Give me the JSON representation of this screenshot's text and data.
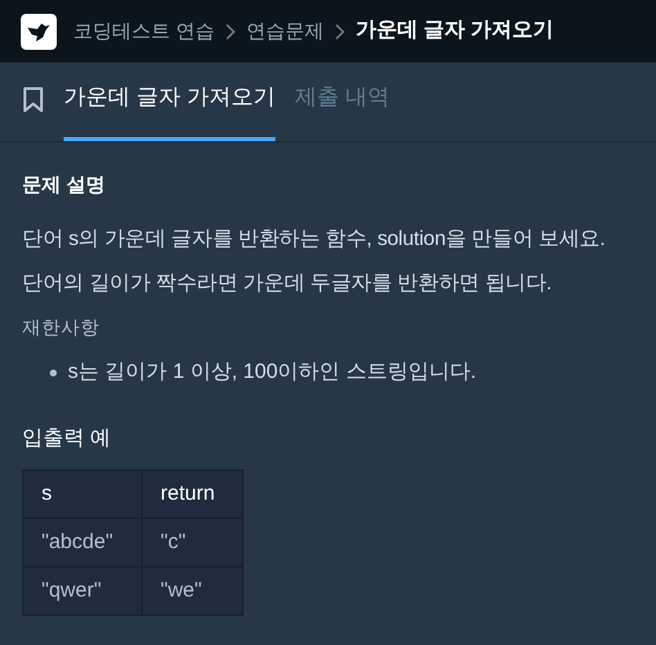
{
  "breadcrumb": [
    {
      "label": "코딩테스트 연습",
      "current": false
    },
    {
      "label": "연습문제",
      "current": false
    },
    {
      "label": "가운데 글자 가져오기",
      "current": true
    }
  ],
  "tabs": [
    {
      "label": "가운데 글자 가져오기",
      "selected": true
    },
    {
      "label": "제출 내역",
      "selected": false
    }
  ],
  "description": {
    "heading": "문제 설명",
    "paragraphs": [
      "단어 s의 가운데 글자를 반환하는 함수, solution을 만들어 보세요.",
      "단어의 길이가 짝수라면 가운데 두글자를 반환하면 됩니다."
    ]
  },
  "constraints": {
    "heading": "재한사항",
    "items": [
      "s는 길이가 1 이상, 100이하인 스트링입니다."
    ]
  },
  "examples": {
    "heading": "입출력 예",
    "columns": [
      "s",
      "return"
    ],
    "rows": [
      [
        "\"abcde\"",
        "\"c\""
      ],
      [
        "\"qwer\"",
        "\"we\""
      ]
    ]
  }
}
